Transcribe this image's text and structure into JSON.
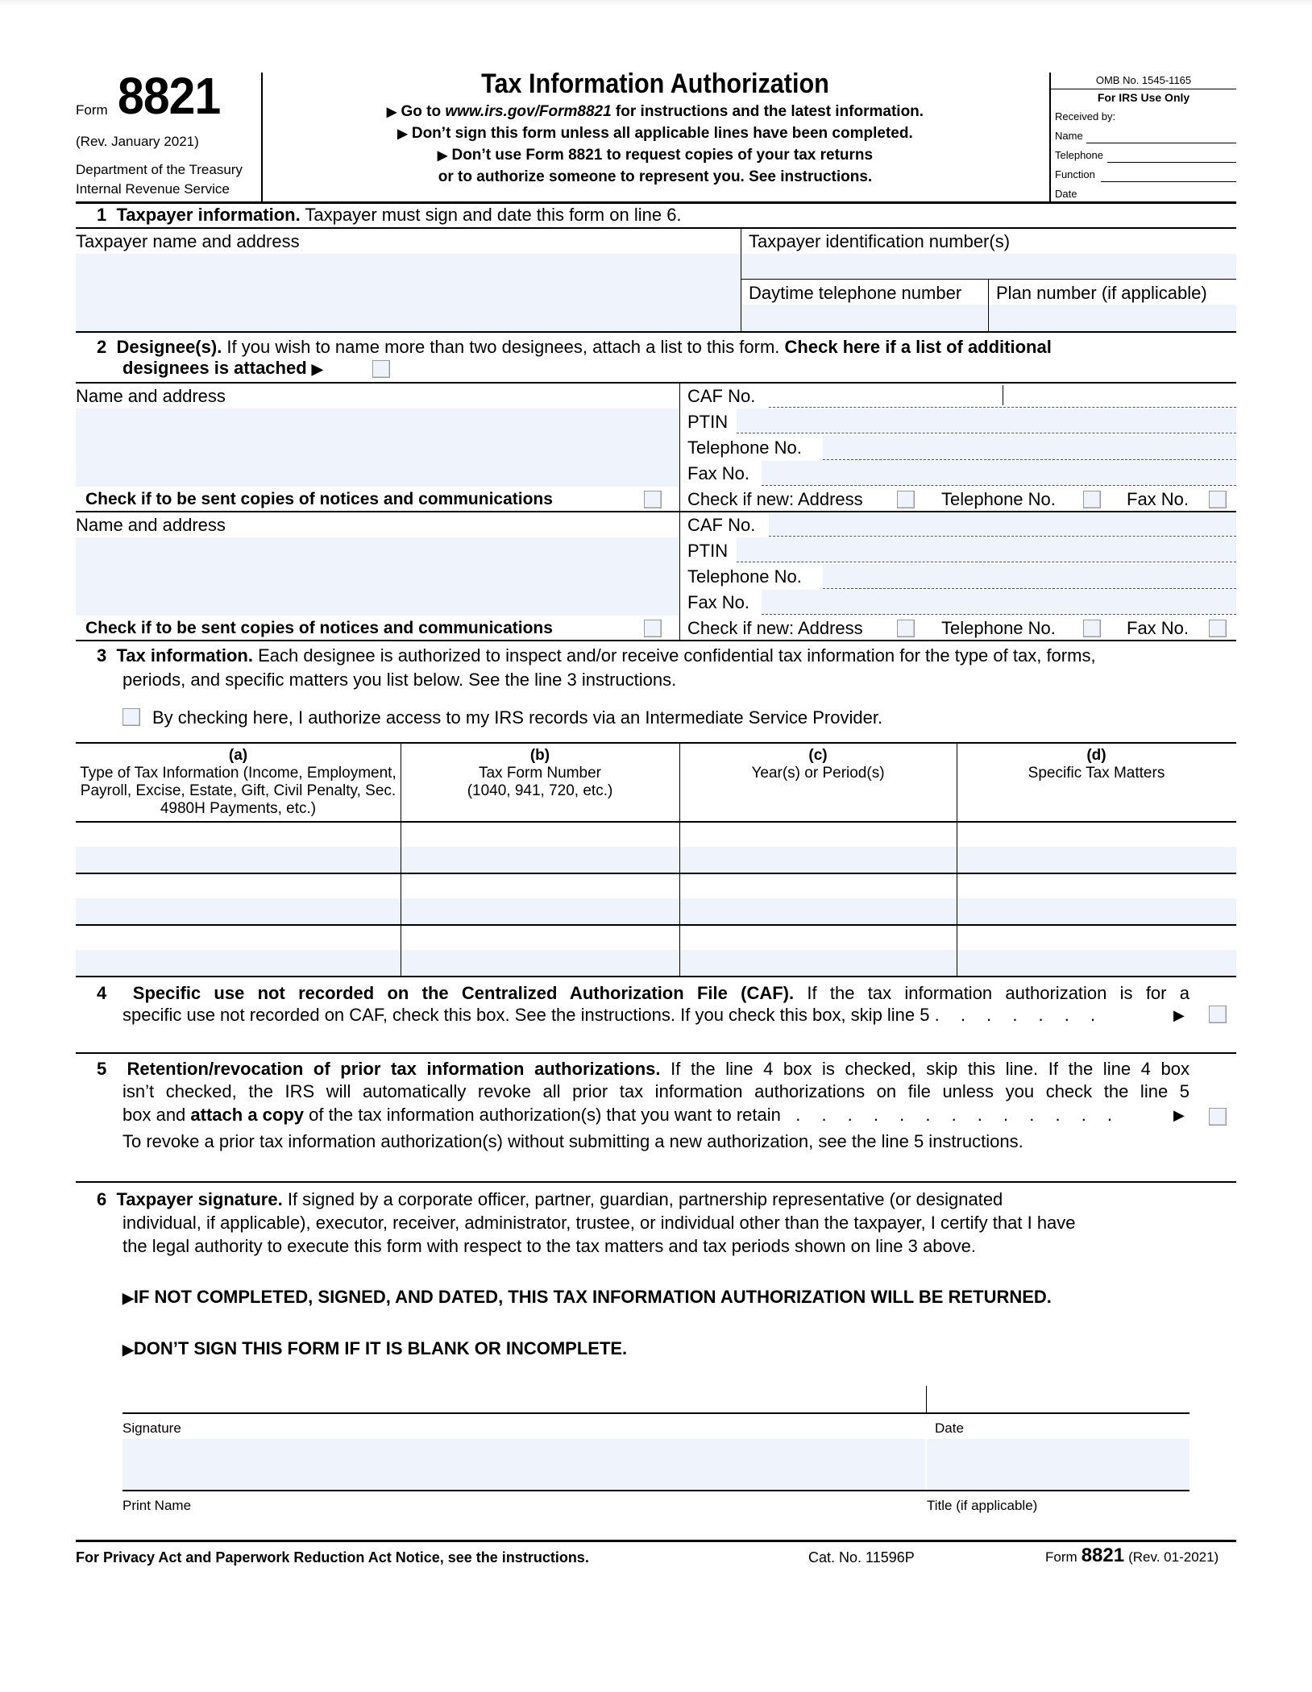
{
  "header": {
    "form_word": "Form",
    "form_number": "8821",
    "revision": "(Rev. January 2021)",
    "department": "Department of the Treasury",
    "agency": "Internal Revenue Service",
    "title": "Tax Information Authorization",
    "instructions": [
      {
        "prefix": "Go to ",
        "link": "www.irs.gov/Form8821",
        "suffix": " for instructions and the latest information."
      },
      {
        "text": "Don’t sign this form unless all applicable lines have been completed."
      },
      {
        "text": "Don’t use Form 8821 to request copies of your tax returns"
      },
      {
        "text": "or to authorize someone to represent you. See instructions."
      }
    ],
    "omb": "OMB No. 1545-1165",
    "irs_use": {
      "title": "For IRS Use Only",
      "received_by": "Received by:",
      "name": "Name",
      "telephone": "Telephone",
      "function": "Function",
      "date": "Date"
    }
  },
  "line1": {
    "number": "1",
    "heading": "Taxpayer information.",
    "text": " Taxpayer must sign and date this form on line 6.",
    "name_address_label": "Taxpayer name and address",
    "tin_label": "Taxpayer identification number(s)",
    "phone_label": "Daytime telephone number",
    "plan_label": "Plan number (if applicable)",
    "name_address_value": "",
    "tin_value": "",
    "phone_value": "",
    "plan_value": ""
  },
  "line2": {
    "number": "2",
    "heading": "Designee(s).",
    "text": " If you wish to name more than two designees, attach a list to this form. ",
    "bold_text": "Check here if a list of additional",
    "bold_text2": "designees is attached",
    "additional_list_checked": false,
    "designees": [
      {
        "name_address_label": "Name and address",
        "caf_label": "CAF No.",
        "ptin_label": "PTIN",
        "telephone_label": "Telephone No.",
        "fax_label": "Fax No.",
        "copies_label": "Check if to be sent copies of notices and communications",
        "check_new_label": "Check if new: Address",
        "new_telephone_label": "Telephone No.",
        "new_fax_label": "Fax No.",
        "name_address_value": "",
        "caf_value": "",
        "ptin_value": "",
        "telephone_value": "",
        "fax_value": "",
        "copies_checked": false,
        "new_address_checked": false,
        "new_telephone_checked": false,
        "new_fax_checked": false
      },
      {
        "name_address_label": "Name and address",
        "caf_label": "CAF No.",
        "ptin_label": "PTIN",
        "telephone_label": "Telephone No.",
        "fax_label": "Fax No.",
        "copies_label": "Check if to be sent copies of notices and communications",
        "check_new_label": "Check if new: Address",
        "new_telephone_label": "Telephone No.",
        "new_fax_label": "Fax No.",
        "name_address_value": "",
        "caf_value": "",
        "ptin_value": "",
        "telephone_value": "",
        "fax_value": "",
        "copies_checked": false,
        "new_address_checked": false,
        "new_telephone_checked": false,
        "new_fax_checked": false
      }
    ]
  },
  "line3": {
    "number": "3",
    "heading": "Tax information.",
    "text1": " Each designee is authorized to inspect and/or receive confidential tax information for the type of tax, forms,",
    "text2": "periods, and specific matters you list below. See the line 3 instructions.",
    "isp_label": "By checking here, I authorize access to my IRS records via an Intermediate Service Provider.",
    "isp_checked": false,
    "columns": [
      {
        "letter": "(a)",
        "label": "Type of Tax Information (Income, Employment, Payroll, Excise, Estate, Gift, Civil Penalty, Sec. 4980H Payments, etc.)"
      },
      {
        "letter": "(b)",
        "label": "Tax Form Number (1040, 941, 720, etc.)"
      },
      {
        "letter": "(c)",
        "label": "Year(s) or Period(s)"
      },
      {
        "letter": "(d)",
        "label": "Specific Tax Matters"
      }
    ],
    "rows": [
      [
        "",
        "",
        "",
        ""
      ],
      [
        "",
        "",
        "",
        ""
      ],
      [
        "",
        "",
        "",
        ""
      ]
    ]
  },
  "line4": {
    "number": "4",
    "heading": "Specific use not recorded on the Centralized Authorization File (CAF).",
    "text1": " If the tax information authorization is for a",
    "text2": "specific use not recorded on CAF, check this box. See the instructions. If you check this box, skip line 5",
    "leader": ". . . . . . .",
    "checked": false
  },
  "line5": {
    "number": "5",
    "heading": "Retention/revocation of prior tax information authorizations.",
    "text1": " If the line 4 box is checked, skip this line. If the line 4 box",
    "text2": "isn’t checked, the IRS will automatically revoke all prior tax information authorizations on file unless you check the line 5",
    "text3_pre": "box and ",
    "text3_bold": "attach a copy",
    "text3_post": " of the tax information authorization(s) that you want to retain",
    "leader": ". . . . . . . . . . . . .",
    "text4": "To revoke a prior tax information authorization(s) without submitting a new authorization, see the line 5 instructions.",
    "checked": false
  },
  "line6": {
    "number": "6",
    "heading": "Taxpayer signature.",
    "text1": " If signed by a corporate officer, partner, guardian, partnership representative (or designated",
    "text2": "individual, if applicable), executor, receiver, administrator, trustee, or individual other than the taxpayer, I certify that I have",
    "text3": "the legal authority to execute this form with respect to the tax matters and tax periods shown on line 3 above.",
    "warning1": "IF NOT COMPLETED, SIGNED, AND DATED, THIS TAX INFORMATION AUTHORIZATION WILL BE RETURNED.",
    "warning2": "DON’T SIGN THIS FORM IF IT IS BLANK OR INCOMPLETE.",
    "signature_label": "Signature",
    "date_label": "Date",
    "print_name_label": "Print Name",
    "title_label": "Title (if applicable)",
    "signature_value": "",
    "date_value": "",
    "print_name_value": "",
    "title_value": ""
  },
  "footer": {
    "privacy": "For Privacy Act and Paperwork Reduction Act Notice, see the instructions.",
    "cat_no": "Cat. No. 11596P",
    "form_word": "Form",
    "form_number": "8821",
    "revision": "(Rev. 01-2021)"
  },
  "icons": {
    "arrow": "▶"
  },
  "colors": {
    "field_fill": "#eef3fc",
    "rule": "#000000"
  }
}
